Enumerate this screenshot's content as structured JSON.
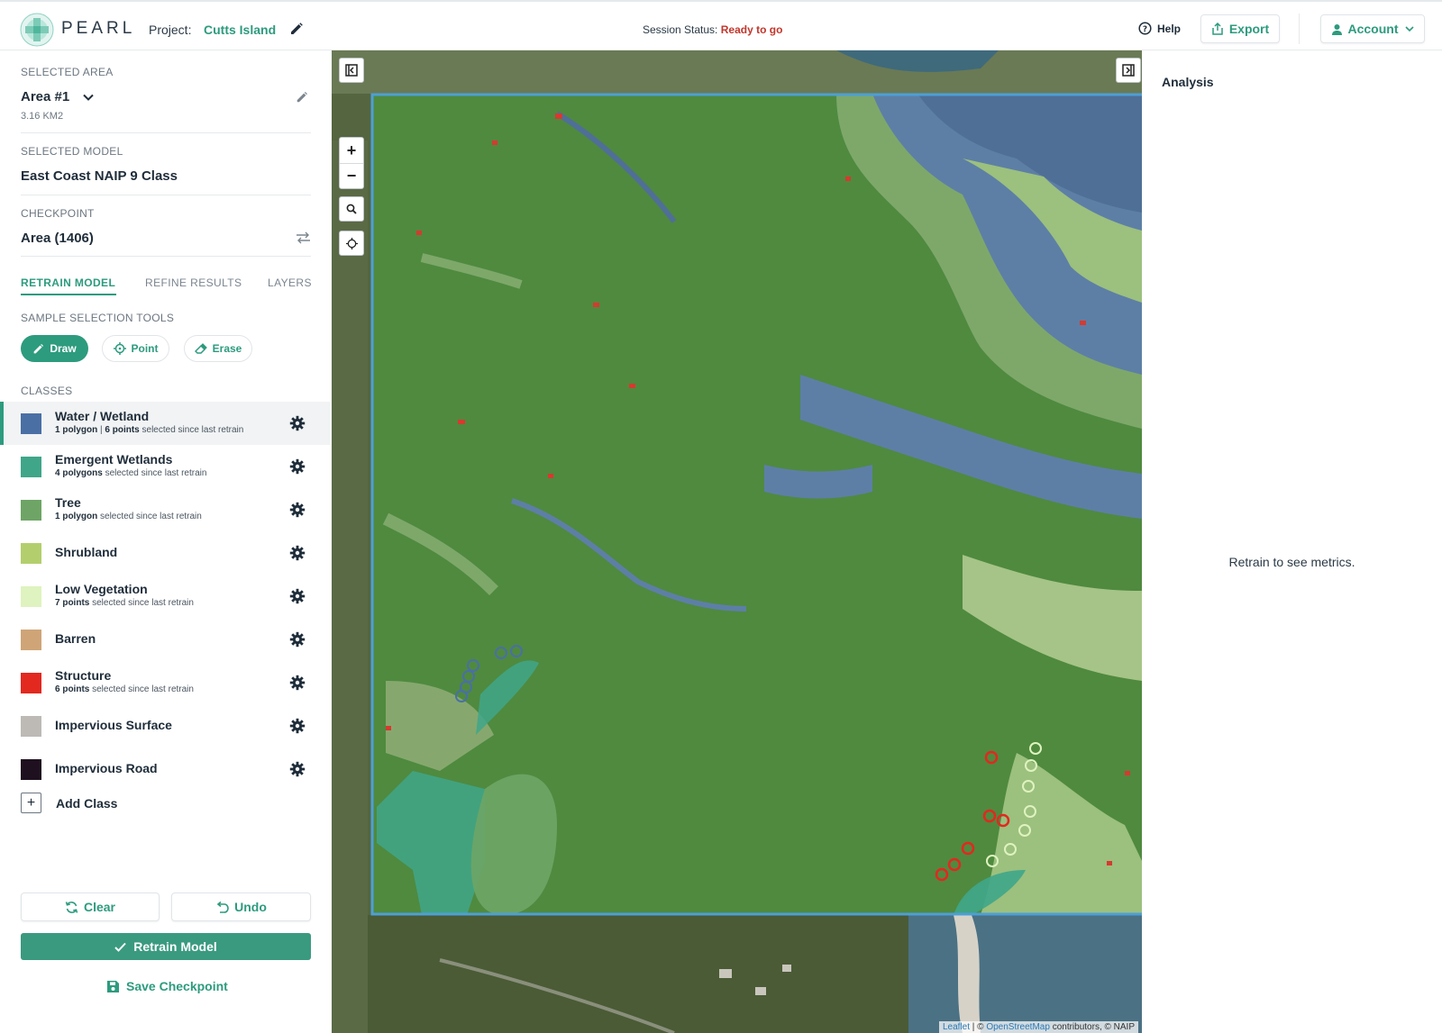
{
  "header": {
    "brand": "PEARL",
    "project_label": "Project:",
    "project_name": "Cutts Island",
    "session_label": "Session Status:",
    "session_value": "Ready to go",
    "help_label": "Help",
    "export_label": "Export",
    "account_label": "Account"
  },
  "sidebar": {
    "selected_area_label": "SELECTED AREA",
    "selected_area_value": "Area #1",
    "selected_area_size": "3.16 KM2",
    "selected_model_label": "SELECTED MODEL",
    "selected_model_value": "East Coast NAIP 9 Class",
    "checkpoint_label": "CHECKPOINT",
    "checkpoint_value": "Area (1406)",
    "tabs": [
      {
        "label": "RETRAIN MODEL",
        "active": true
      },
      {
        "label": "REFINE RESULTS",
        "active": false
      },
      {
        "label": "LAYERS",
        "active": false
      }
    ],
    "tools_label": "SAMPLE SELECTION TOOLS",
    "tools": [
      {
        "label": "Draw",
        "active": true
      },
      {
        "label": "Point",
        "active": false
      },
      {
        "label": "Erase",
        "active": false
      }
    ],
    "classes_label": "CLASSES",
    "classes": [
      {
        "name": "Water / Wetland",
        "color": "#4a6fa5",
        "meta_bold1": "1 polygon",
        "meta_sep": " | ",
        "meta_bold2": "6 points",
        "meta_text": " selected since last retrain",
        "active": true
      },
      {
        "name": "Emergent Wetlands",
        "color": "#3fa68a",
        "meta_bold1": "4 polygons",
        "meta_sep": "",
        "meta_bold2": "",
        "meta_text": " selected since last retrain",
        "active": false
      },
      {
        "name": "Tree",
        "color": "#6ea566",
        "meta_bold1": "1 polygon",
        "meta_sep": "",
        "meta_bold2": "",
        "meta_text": " selected since last retrain",
        "active": false
      },
      {
        "name": "Shrubland",
        "color": "#b3cf6d",
        "meta_bold1": "",
        "meta_sep": "",
        "meta_bold2": "",
        "meta_text": "",
        "active": false
      },
      {
        "name": "Low Vegetation",
        "color": "#def3bf",
        "meta_bold1": "7 points",
        "meta_sep": "",
        "meta_bold2": "",
        "meta_text": " selected since last retrain",
        "active": false
      },
      {
        "name": "Barren",
        "color": "#cfa577",
        "meta_bold1": "",
        "meta_sep": "",
        "meta_bold2": "",
        "meta_text": "",
        "active": false
      },
      {
        "name": "Structure",
        "color": "#e2281f",
        "meta_bold1": "6 points",
        "meta_sep": "",
        "meta_bold2": "",
        "meta_text": " selected since last retrain",
        "active": false
      },
      {
        "name": "Impervious Surface",
        "color": "#bdbab6",
        "meta_bold1": "",
        "meta_sep": "",
        "meta_bold2": "",
        "meta_text": "",
        "active": false
      },
      {
        "name": "Impervious Road",
        "color": "#1f1020",
        "meta_bold1": "",
        "meta_sep": "",
        "meta_bold2": "",
        "meta_text": "",
        "active": false
      }
    ],
    "add_class_label": "Add Class",
    "clear_label": "Clear",
    "undo_label": "Undo",
    "retrain_label": "Retrain Model",
    "save_label": "Save Checkpoint"
  },
  "map": {
    "zoom_in": "+",
    "zoom_out": "−",
    "attribution_leaflet": "Leaflet",
    "attribution_sep": " | © ",
    "attribution_osm": "OpenStreetMap",
    "attribution_rest": " contributors, © NAIP"
  },
  "analysis": {
    "title": "Analysis",
    "message": "Retrain to see metrics."
  },
  "colors": {
    "accent": "#2d9b7e",
    "status_ready": "#c2362b",
    "aoi_border": "#4d9fd6"
  }
}
